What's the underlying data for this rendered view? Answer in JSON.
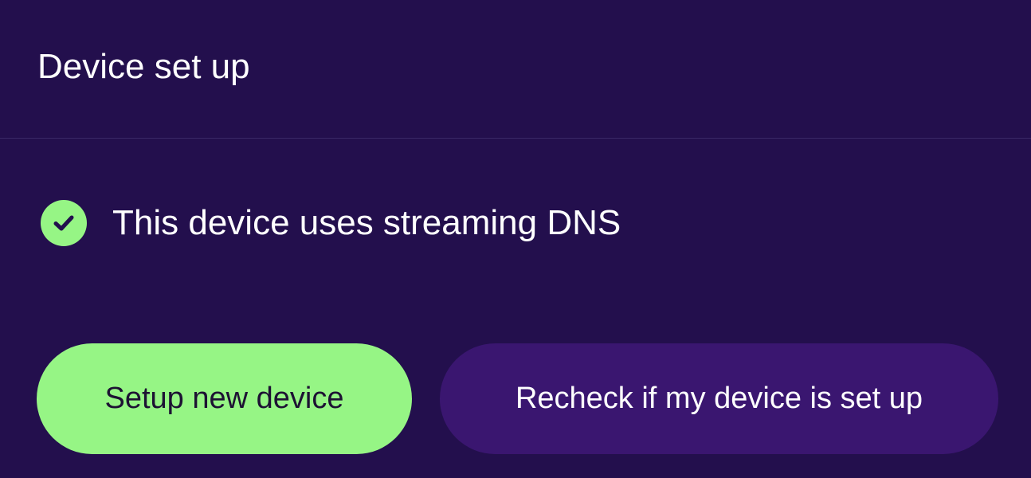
{
  "header": {
    "title": "Device set up"
  },
  "status": {
    "icon": "check-circle-icon",
    "text": "This device uses streaming DNS",
    "color": "#96f585"
  },
  "actions": {
    "setup_label": "Setup new device",
    "recheck_label": "Recheck if my device is set up"
  },
  "colors": {
    "background": "#230f4d",
    "accent": "#96f585",
    "secondary_button": "#3a1670"
  }
}
